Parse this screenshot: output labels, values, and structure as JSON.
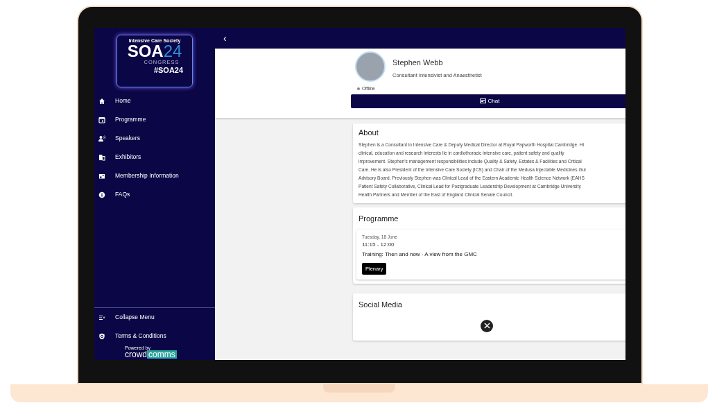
{
  "logo": {
    "society": "Intensive Care Society",
    "mark": "SOA",
    "year": "24",
    "subtitle": "CONGRESS",
    "hashtag": "#SOA24"
  },
  "sidebar": {
    "items": [
      {
        "label": "Home",
        "kind": "home"
      },
      {
        "label": "Programme",
        "kind": "calendar"
      },
      {
        "label": "Speakers",
        "kind": "speaker"
      },
      {
        "label": "Exhibitors",
        "kind": "building"
      },
      {
        "label": "Membership Information",
        "kind": "grid"
      },
      {
        "label": "FAQs",
        "kind": "info"
      }
    ],
    "footer_items": [
      {
        "label": "Collapse Menu",
        "kind": "collapse"
      },
      {
        "label": "Terms & Conditions",
        "kind": "shield"
      }
    ],
    "powered_by": {
      "caption": "Powered by",
      "brand_left": "crowd",
      "brand_right": "comms"
    }
  },
  "top_bar": {
    "back": "‹"
  },
  "profile": {
    "name": "Stephen Webb",
    "role": "Consultant Intensivist and Anaesthetist",
    "status": "Offline",
    "online": false,
    "chat_button": "Chat"
  },
  "about": {
    "title": "About",
    "lines": [
      "Stephen is a Consultant in Intensive Care & Deputy Medical Director at Royal Papworth Hospital Cambridge. Hi",
      "clinical, education and research interests lie in cardiothoracic intensive care, patient safety and quality",
      "improvement. Stephen's management responsibilities include Quality & Safety, Estates & Facilities and Critical",
      "Care. He is also President of the Intensive Care Society (ICS) and Chair of the Medusa Injectable Medicines Gui",
      "Advisory Board. Previously Stephen was Clinical Lead of the Eastern Academic Health Science Network (EAHS",
      "Patient Safety Collaborative, Clinical Lead for Postgraduate Leadership Development at Cambridge University",
      "Health Partners and Member of the East of England Clinical Senate Council."
    ]
  },
  "programme": {
    "title": "Programme",
    "sessions": [
      {
        "date": "Tuesday, 18 June",
        "time": "11:15 - 12:00",
        "title": "Training: Then and now - A view from the GMC",
        "tag": "Plenary"
      }
    ]
  },
  "social_media": {
    "title": "Social Media",
    "links": [
      {
        "kind": "x"
      }
    ]
  }
}
